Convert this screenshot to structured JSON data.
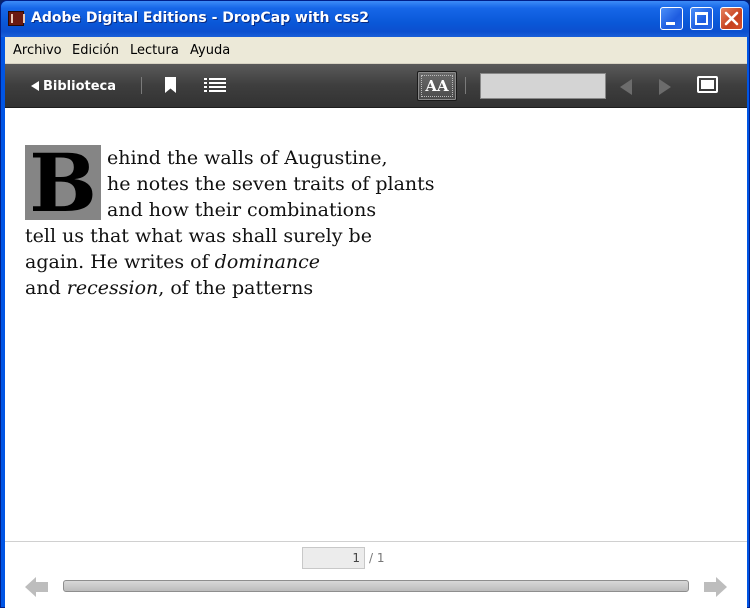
{
  "window": {
    "title": "Adobe Digital Editions - DropCap with css2"
  },
  "menu": {
    "items": [
      {
        "label": "Archivo"
      },
      {
        "label": "Edición"
      },
      {
        "label": "Lectura"
      },
      {
        "label": "Ayuda"
      }
    ]
  },
  "toolbar": {
    "library_label": "Biblioteca",
    "font_button_label": "AA",
    "search_value": ""
  },
  "content": {
    "dropcap": "B",
    "lines": [
      {
        "text": "ehind the walls of Augustine,"
      },
      {
        "text": "he notes the seven traits of plants"
      },
      {
        "text": "and how their combinations"
      },
      {
        "text": "tell us that what was shall surely be"
      },
      {
        "pre": "again. He writes of ",
        "em": "dominance",
        "post": ""
      },
      {
        "pre": "and ",
        "em": "recession",
        "post": ", of the patterns"
      }
    ]
  },
  "pager": {
    "current_page": "1",
    "total_pages": "/ 1"
  },
  "colors": {
    "titlebar": "#0a58d8",
    "toolbar": "#3e3e3e",
    "dropcap_bg": "#858585"
  }
}
